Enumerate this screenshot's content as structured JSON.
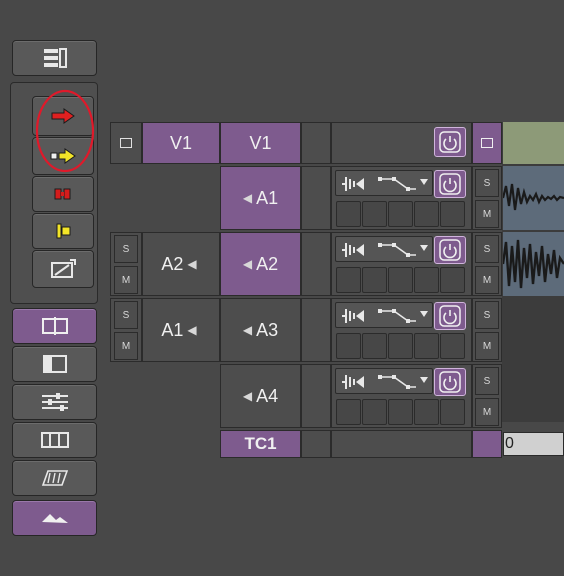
{
  "tracks": {
    "source_v1": "V1",
    "record_v1": "V1",
    "a1": "A1",
    "source_a2": "A2",
    "a2": "A2",
    "source_a1": "A1",
    "a3": "A3",
    "a4": "A4",
    "tc1": "TC1"
  },
  "solo_label": "S",
  "mute_label": "M",
  "timecode_fragment": "0",
  "colors": {
    "track_selected": "#7e5b8e",
    "annotation_circle": "#e0192a",
    "video_clip": "#8d9a78",
    "audio_clip": "#5d6b7a"
  },
  "icons": {
    "sidebar": [
      "track-list-icon",
      "splice-in-icon",
      "overwrite-icon",
      "lift-icon",
      "extract-icon",
      "top-trim-icon",
      "timeline-view-icon",
      "source-monitor-toggle-icon",
      "mixer-icon",
      "film-strip-icon",
      "effect-mode-icon",
      "audio-waveform-toggle-icon"
    ],
    "track_controls": [
      "waveform-icon",
      "keyframe-icon",
      "power-icon"
    ]
  }
}
